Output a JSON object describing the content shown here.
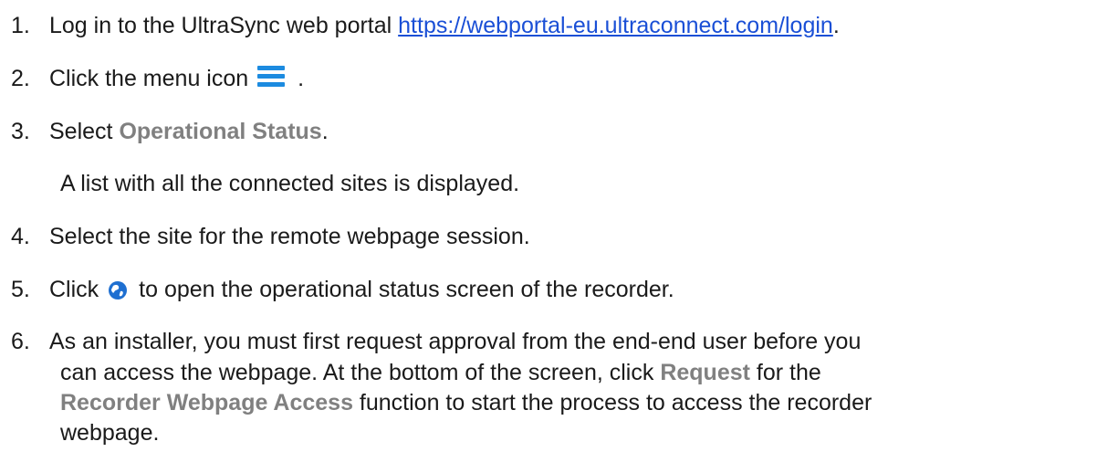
{
  "steps": [
    {
      "num": "1.",
      "text": "Log in to the UltraSync web portal ",
      "link": "https://webportal-eu.ultraconnect.com/login",
      "end": "."
    },
    {
      "num": "2.",
      "text": "Click the menu icon",
      "end": ".",
      "icon": "menu-icon"
    },
    {
      "num": "3.",
      "text": "Select ",
      "ui": "Operational Status",
      "end": "."
    },
    {
      "note": "A list with all the connected sites is displayed."
    },
    {
      "num": "4.",
      "text": "Select the site for the remote webpage session."
    },
    {
      "num": "5.",
      "text_before": "Click",
      "icon": "globe-icon",
      "text": "to open the operational status screen of the recorder."
    },
    {
      "num": "6.",
      "line1": "As an installer, you must first request approval from the end-end user before you",
      "line2_a": "can access the webpage. At the bottom of the screen, click ",
      "line2_ui": "Request",
      "line2_b": " for the",
      "line3_ui": "Recorder Webpage Access",
      "line3_b": " function to start the process to access the recorder",
      "line4": "webpage."
    }
  ],
  "colors": {
    "text": "#1a1a1a",
    "link": "#1a4fd6",
    "ui_term": "#808080",
    "menu_icon": "#1c8be0",
    "globe_icon": "#1e6fd1"
  }
}
